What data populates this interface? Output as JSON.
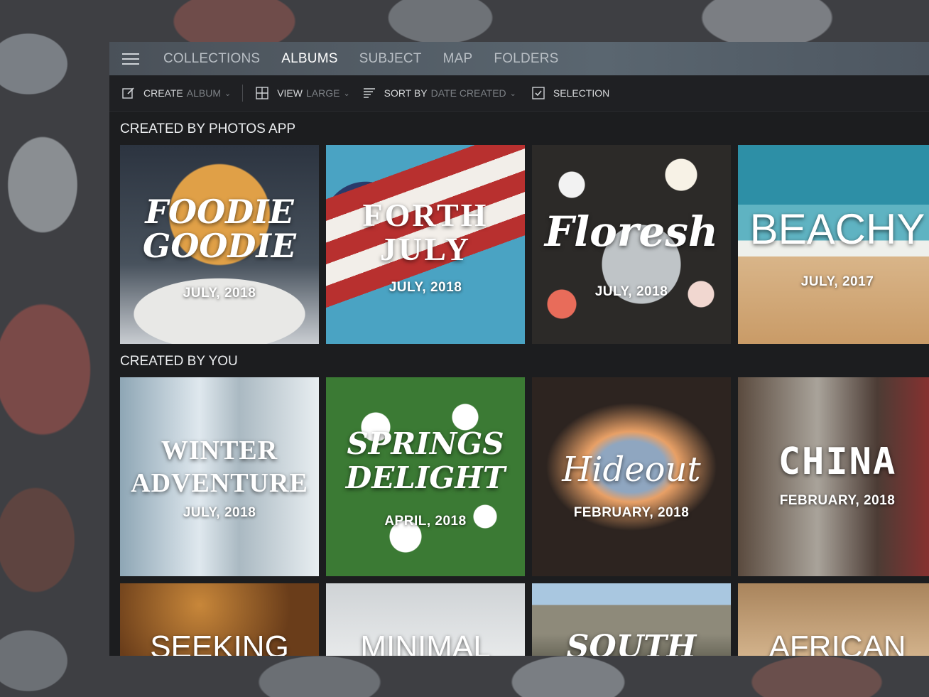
{
  "nav": {
    "tabs": [
      "COLLECTIONS",
      "ALBUMS",
      "SUBJECT",
      "MAP",
      "FOLDERS"
    ],
    "active": "ALBUMS"
  },
  "toolbar": {
    "create_label": "CREATE",
    "create_value": "ALBUM",
    "view_label": "VIEW",
    "view_value": "LARGE",
    "sort_label": "SORT BY",
    "sort_value": "DATE CREATED",
    "selection_label": "SELECTION"
  },
  "sections": [
    {
      "title": "CREATED BY PHOTOS APP",
      "albums": [
        {
          "title": "FOODIE GOODIE",
          "date": "JULY, 2018"
        },
        {
          "title": "FORTH JULY",
          "date": "JULY, 2018"
        },
        {
          "title": "Floresh",
          "date": "JULY, 2018"
        },
        {
          "title": "BEACHY",
          "date": "JULY, 2017"
        }
      ]
    },
    {
      "title": "CREATED BY YOU",
      "albums": [
        {
          "title": "WINTER ADVENTURE",
          "date": "JULY, 2018"
        },
        {
          "title": "SPRINGS DELIGHT",
          "date": "APRIL, 2018"
        },
        {
          "title": "Hideout",
          "date": "FEBRUARY, 2018"
        },
        {
          "title": "CHINA",
          "date": "FEBRUARY, 2018"
        },
        {
          "title": "SEEKING",
          "date": ""
        },
        {
          "title": "MINIMAL",
          "date": ""
        },
        {
          "title": "SOUTH",
          "date": ""
        },
        {
          "title": "AFRICAN",
          "date": ""
        }
      ]
    }
  ],
  "icons": {
    "menu": "hamburger-icon",
    "create": "edit-icon",
    "view": "grid-icon",
    "sort": "sort-lines-icon",
    "selection": "checkbox-icon"
  }
}
